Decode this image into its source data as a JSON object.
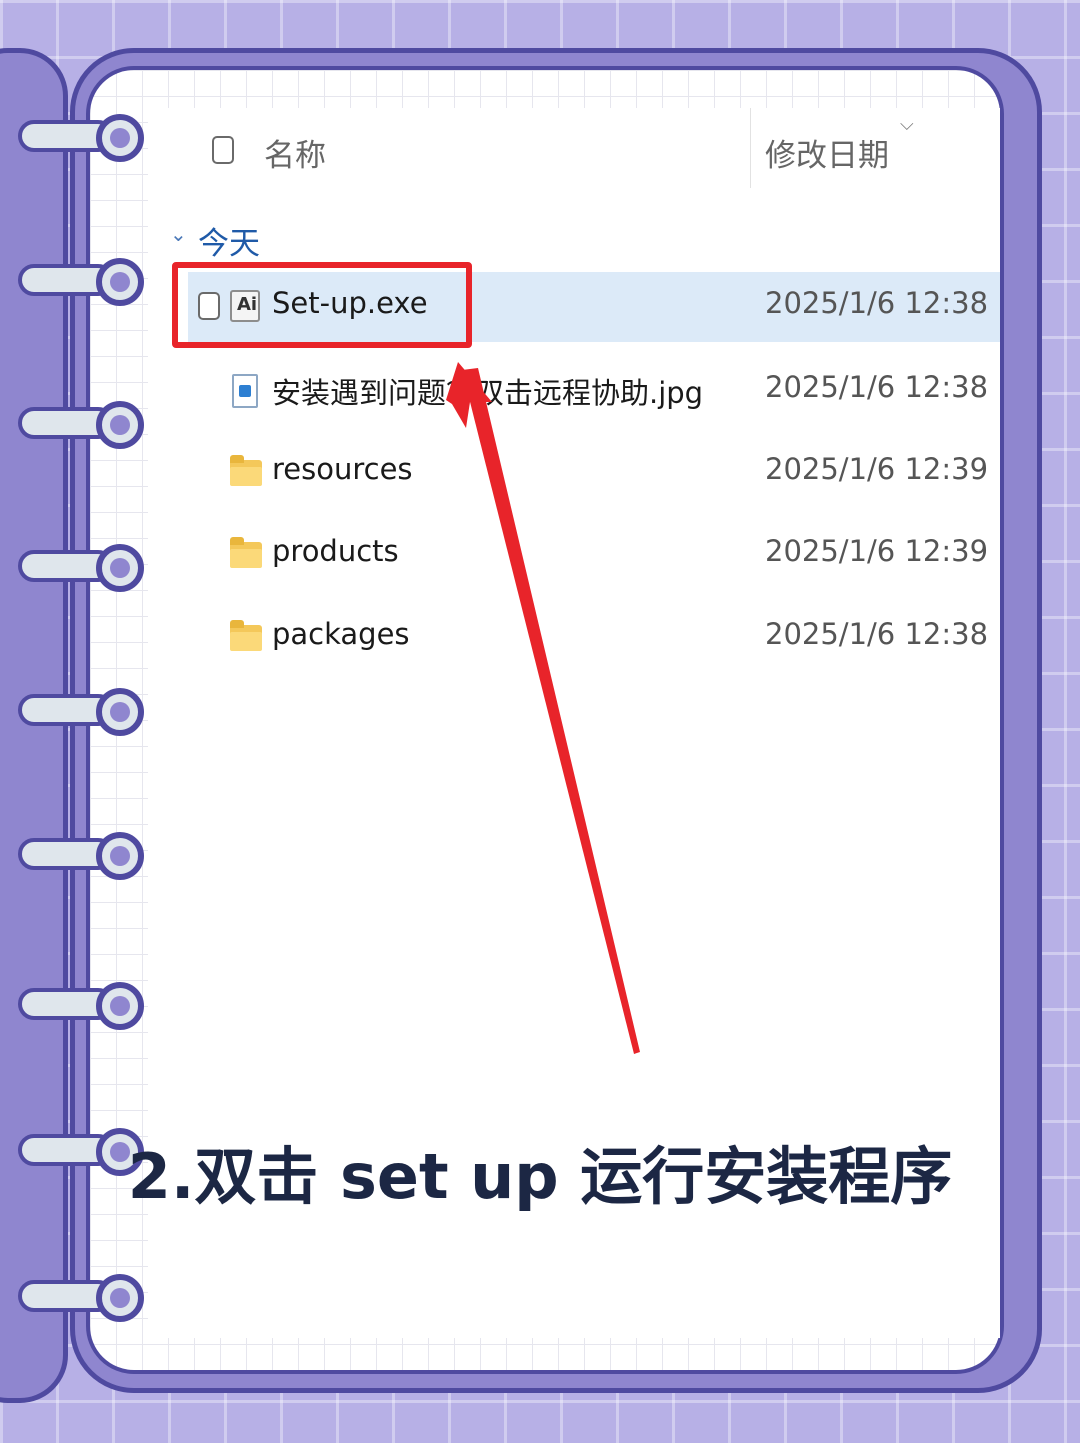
{
  "header": {
    "name_label": "名称",
    "date_label": "修改日期"
  },
  "group": {
    "label": "今天"
  },
  "files": [
    {
      "name": "Set-up.exe",
      "date": "2025/1/6 12:38",
      "type": "exe",
      "selected": true
    },
    {
      "name": "安装遇到问题？双击远程协助.jpg",
      "date": "2025/1/6 12:38",
      "type": "image",
      "selected": false
    },
    {
      "name": "resources",
      "date": "2025/1/6 12:39",
      "type": "folder",
      "selected": false
    },
    {
      "name": "products",
      "date": "2025/1/6 12:39",
      "type": "folder",
      "selected": false
    },
    {
      "name": "packages",
      "date": "2025/1/6 12:38",
      "type": "folder",
      "selected": false
    }
  ],
  "caption": "2.双击 set up 运行安装程序",
  "colors": {
    "background": "#b7b0e6",
    "binder": "#8f86cf",
    "outline": "#4f4aa0",
    "selection": "#dceaf8",
    "highlight": "#e8242a",
    "caption_text": "#1c2744"
  },
  "icons": {
    "exe": "adobe-installer-icon",
    "image": "image-file-icon",
    "folder": "folder-icon"
  }
}
